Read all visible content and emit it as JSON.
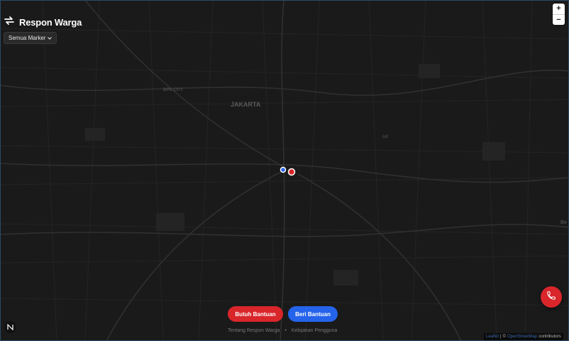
{
  "app": {
    "title": "Respon Warga"
  },
  "filter": {
    "label": "Semua Marker"
  },
  "zoom": {
    "in": "+",
    "out": "−"
  },
  "map_labels": {
    "city": "JAKARTA",
    "district_1": "DPR CITY",
    "district_2": "Jati",
    "district_3": "Be"
  },
  "actions": {
    "need_help": "Butuh Bantuan",
    "give_help": "Beri Bantuan"
  },
  "footer": {
    "about": "Tentang Respon Warga",
    "sep": "•",
    "policy": "Kebijakan Pengguna"
  },
  "attribution": {
    "leaflet": "Leaflet",
    "sep": "|",
    "copy": "©",
    "osm": "OpenStreetMap",
    "suffix": "contributors"
  },
  "colors": {
    "background": "#1a1a1a",
    "need_help": "#d8262b",
    "give_help": "#2563eb"
  },
  "icons": {
    "brand": "repeat-arrows-icon",
    "compass": "compass-icon",
    "call": "phone-icon",
    "dropdown": "chevron-down-icon"
  }
}
